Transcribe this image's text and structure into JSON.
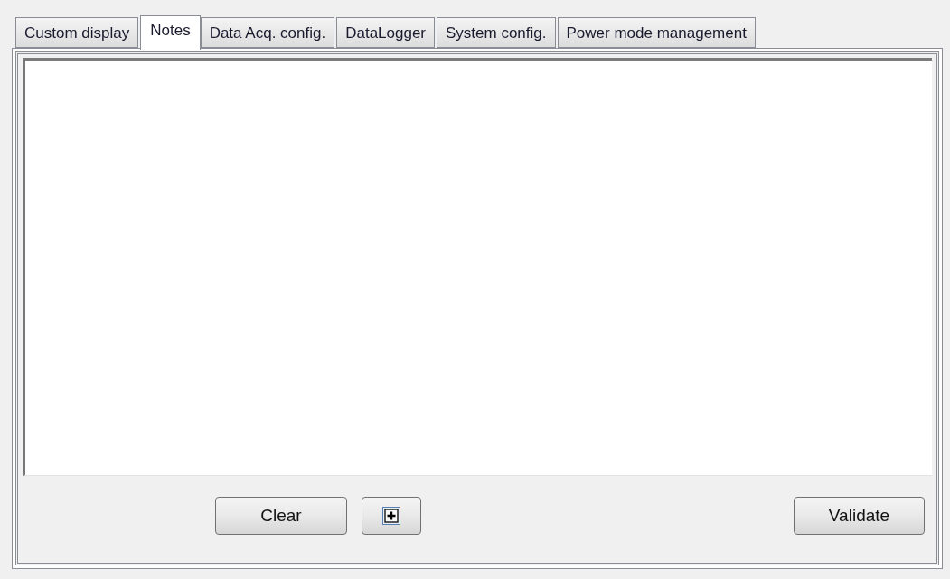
{
  "tabs": [
    {
      "label": "Custom display",
      "selected": false
    },
    {
      "label": "Notes",
      "selected": true
    },
    {
      "label": "Data Acq. config.",
      "selected": false
    },
    {
      "label": "DataLogger",
      "selected": false
    },
    {
      "label": "System config.",
      "selected": false
    },
    {
      "label": "Power mode management",
      "selected": false
    }
  ],
  "notes": {
    "clear_button": "Clear",
    "validate_button": "Validate"
  }
}
